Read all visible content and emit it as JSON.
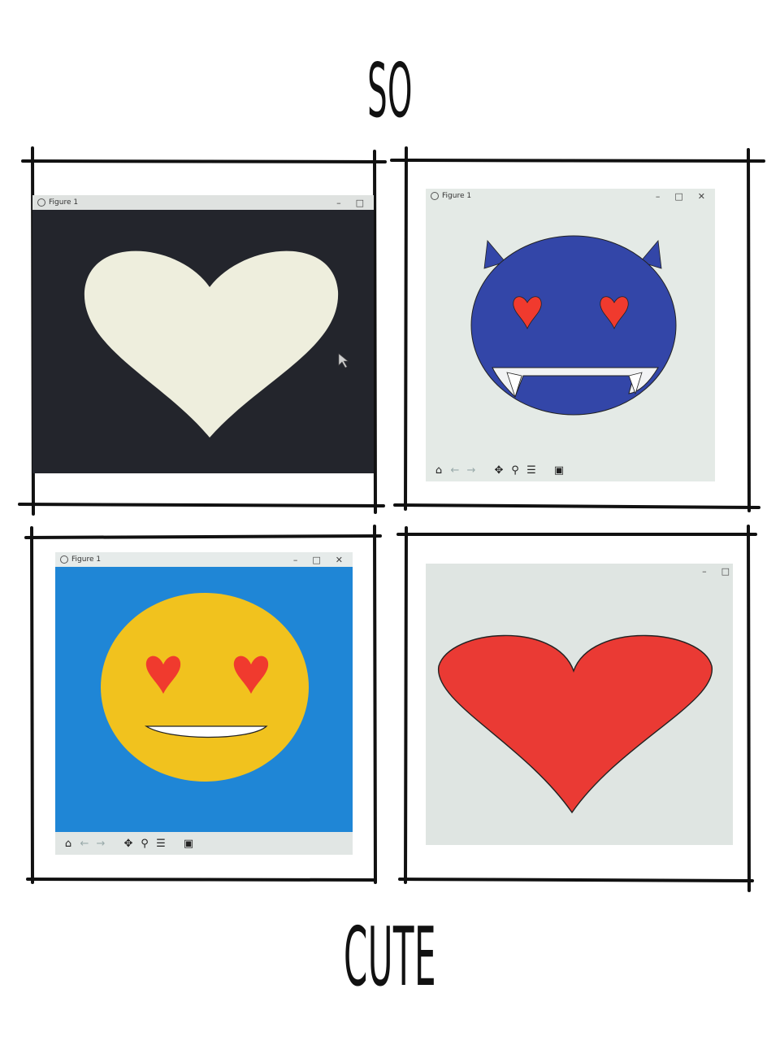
{
  "headline_top": "SO",
  "headline_bottom": "CUTE",
  "colors": {
    "screen_dark": "#23252c",
    "heart_cream": "#eeeedd",
    "window_light": "#e4eae6",
    "devil_blue": "#3346a8",
    "eye_heart_red": "#f03a2e",
    "sky_blue": "#1f86d6",
    "emoji_yellow": "#f1c21e",
    "big_heart_red": "#ea3a34"
  },
  "panels": [
    {
      "id": "white-heart",
      "window_title": "Figure 1",
      "window_controls": [
        "–",
        "□"
      ]
    },
    {
      "id": "devil-emoji",
      "window_title": "Figure 1",
      "window_controls": [
        "–",
        "□",
        "✕"
      ],
      "toolbar_icons": [
        "home-icon",
        "back-arrow-icon",
        "forward-arrow-icon",
        "pan-icon",
        "zoom-icon",
        "configure-icon",
        "save-icon"
      ]
    },
    {
      "id": "heart-eyes-emoji",
      "window_title": "Figure 1",
      "window_controls": [
        "–",
        "□",
        "✕"
      ],
      "toolbar_icons": [
        "home-icon",
        "back-arrow-icon",
        "forward-arrow-icon",
        "pan-icon",
        "zoom-icon",
        "configure-icon",
        "save-icon"
      ]
    },
    {
      "id": "red-heart",
      "window_controls": [
        "–",
        "□"
      ]
    }
  ]
}
